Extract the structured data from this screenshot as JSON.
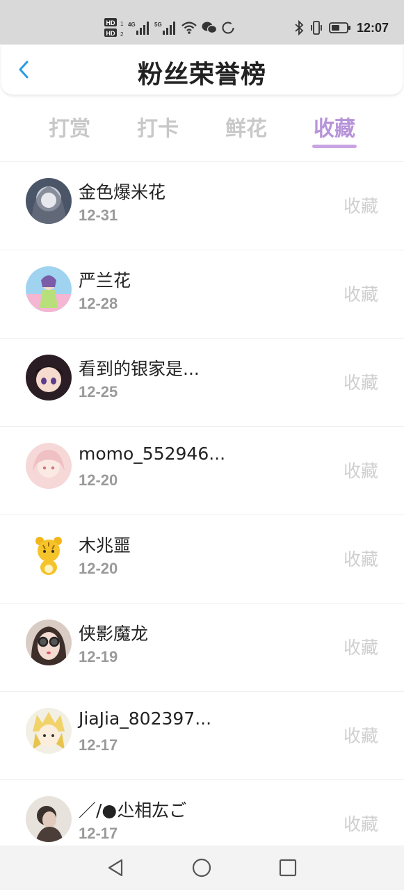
{
  "status_bar": {
    "time": "12:07",
    "icons": [
      "hd1-icon",
      "hd2-icon",
      "signal-4g-icon",
      "signal-5g-icon",
      "wifi-icon",
      "wechat-icon",
      "loading-icon",
      "bluetooth-icon",
      "vibrate-icon",
      "battery-icon"
    ],
    "hd1_label": "HD",
    "hd2_label": "HD",
    "net1_label": "4G",
    "net2_label": "5G"
  },
  "header": {
    "title": "粉丝荣誉榜",
    "back_icon": "chevron-left-icon",
    "accent_color": "#2a9be8"
  },
  "tabs": [
    {
      "label": "打赏",
      "active": false
    },
    {
      "label": "打卡",
      "active": false
    },
    {
      "label": "鲜花",
      "active": false
    },
    {
      "label": "收藏",
      "active": true
    }
  ],
  "active_color": "#b793d9",
  "fans": [
    {
      "name": "金色爆米花",
      "date": "12-31",
      "action": "收藏"
    },
    {
      "name": "严兰花",
      "date": "12-28",
      "action": "收藏"
    },
    {
      "name": "看到的银家是...",
      "date": "12-25",
      "action": "收藏"
    },
    {
      "name": "momo_552946...",
      "date": "12-20",
      "action": "收藏"
    },
    {
      "name": "木兆噩",
      "date": "12-20",
      "action": "收藏"
    },
    {
      "name": "侠影魔龙",
      "date": "12-19",
      "action": "收藏"
    },
    {
      "name": "JiaJia_802397...",
      "date": "12-17",
      "action": "收藏"
    },
    {
      "name": "／/●尐相厷ご",
      "date": "12-17",
      "action": "收藏"
    }
  ],
  "nav_bar": {
    "icons": [
      "back-triangle-icon",
      "home-circle-icon",
      "recent-square-icon"
    ]
  }
}
